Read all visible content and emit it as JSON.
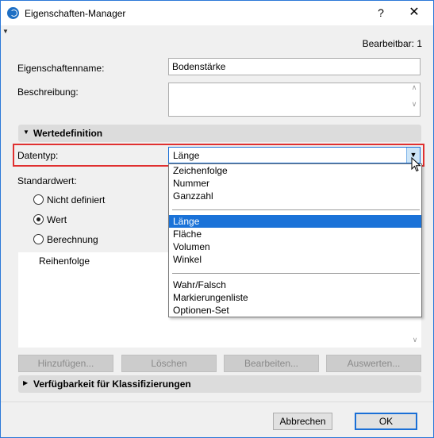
{
  "window": {
    "title": "Eigenschaften-Manager",
    "help_label": "?",
    "close_label": "✕"
  },
  "editable_label": "Bearbeitbar: 1",
  "form": {
    "name_label": "Eigenschaftenname:",
    "name_value": "Bodenstärke",
    "description_label": "Beschreibung:",
    "description_value": ""
  },
  "value_definition": {
    "section_label": "Wertedefinition",
    "datatype_label": "Datentyp:",
    "datatype_value": "Länge",
    "default_label": "Standardwert:",
    "radios": [
      {
        "label": "Nicht definiert",
        "checked": false
      },
      {
        "label": "Wert",
        "checked": true
      },
      {
        "label": "Berechnung",
        "checked": false
      }
    ],
    "list_header": "Reihenfolge"
  },
  "dropdown": {
    "groups": [
      [
        "Zeichenfolge",
        "Nummer",
        "Ganzzahl"
      ],
      [
        "Länge",
        "Fläche",
        "Volumen",
        "Winkel"
      ],
      [
        "Wahr/Falsch",
        "Markierungenliste",
        "Optionen-Set"
      ]
    ],
    "selected": "Länge"
  },
  "list_buttons": [
    "Hinzufügen...",
    "Löschen",
    "Bearbeiten...",
    "Auswerten..."
  ],
  "classification_section": "Verfügbarkeit für Klassifizierungen",
  "footer": {
    "cancel_label": "Abbrechen",
    "ok_label": "OK"
  },
  "icons": {
    "app": "archicad-icon",
    "section_expanded": "triangle-down-icon",
    "section_collapsed": "triangle-right-icon",
    "dropdown_arrow": "chevron-down-icon",
    "cursor": "mouse-pointer-icon"
  },
  "colors": {
    "accent": "#1a72d8",
    "highlight_border": "#e03030"
  }
}
